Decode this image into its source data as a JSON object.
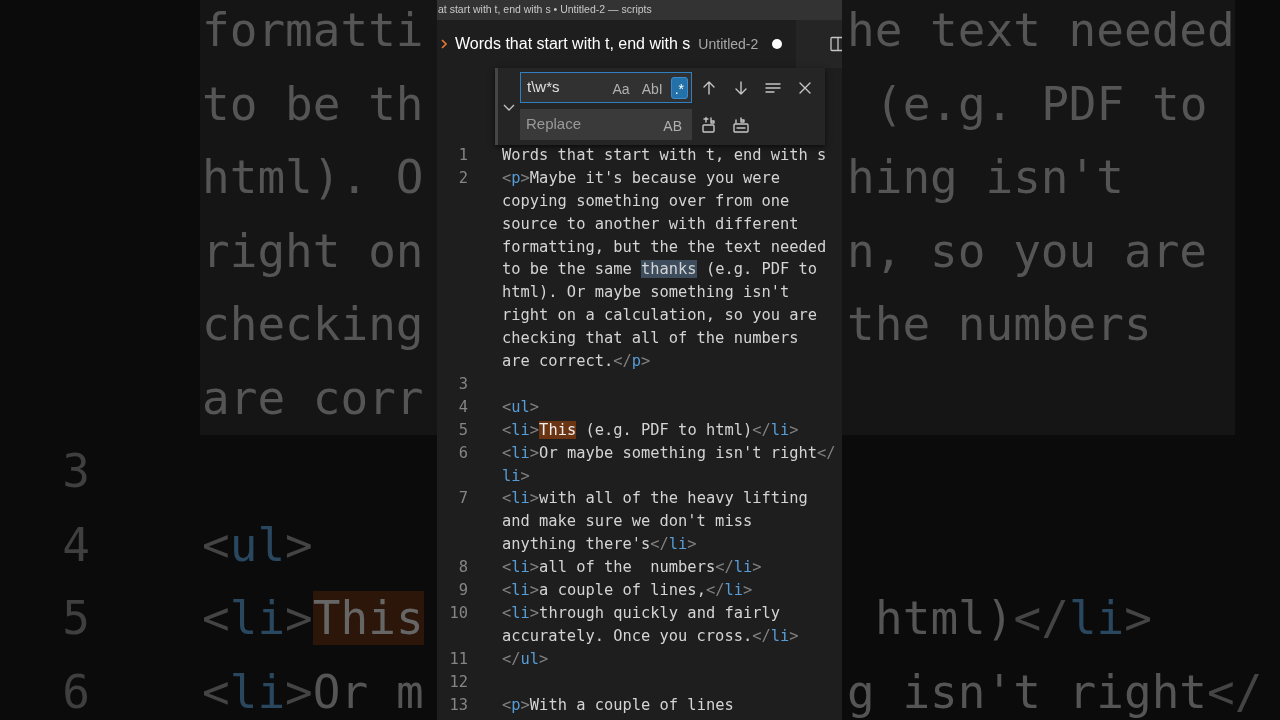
{
  "window": {
    "title": "at start with t, end with s • Untitled-2 — scripts"
  },
  "tab": {
    "title": "Words that start with t, end with s",
    "description": "Untitled-2",
    "dirty": true
  },
  "find": {
    "expanded": true,
    "query": "t\\w*s",
    "toggles": [
      {
        "label": "Aa",
        "on": false
      },
      {
        "label": "AbI",
        "on": false
      },
      {
        "label": ".*",
        "on": true
      }
    ],
    "replace": {
      "placeholder": "Replace",
      "toggles": [
        {
          "label": "AB",
          "on": false
        }
      ]
    }
  },
  "editor": {
    "lines": [
      {
        "number": "1",
        "rows": [
          {
            "tokens": [
              {
                "kind": "text",
                "text": "Words that start with t, end with s"
              }
            ]
          }
        ]
      },
      {
        "number": "2",
        "rows": [
          {
            "tokens": [
              {
                "kind": "punct",
                "text": "<"
              },
              {
                "kind": "tag",
                "text": "p"
              },
              {
                "kind": "punct",
                "text": ">"
              },
              {
                "kind": "text",
                "text": "Maybe it's because you were"
              }
            ]
          },
          {
            "tokens": [
              {
                "kind": "text",
                "text": "copying something over from one"
              }
            ]
          },
          {
            "tokens": [
              {
                "kind": "text",
                "text": "source to another with different"
              }
            ]
          },
          {
            "tokens": [
              {
                "kind": "text",
                "text": "formatting, but the the text needed"
              }
            ]
          },
          {
            "tokens": [
              {
                "kind": "text",
                "text": "to be the same "
              },
              {
                "kind": "match",
                "text": "thanks"
              },
              {
                "kind": "text",
                "text": " (e.g. PDF to"
              }
            ]
          },
          {
            "tokens": [
              {
                "kind": "text",
                "text": "html). Or maybe something isn't"
              }
            ]
          },
          {
            "tokens": [
              {
                "kind": "text",
                "text": "right on a calculation, so you are"
              }
            ]
          },
          {
            "tokens": [
              {
                "kind": "text",
                "text": "checking that all of the numbers"
              }
            ]
          },
          {
            "tokens": [
              {
                "kind": "text",
                "text": "are correct."
              },
              {
                "kind": "punct",
                "text": "</"
              },
              {
                "kind": "tag",
                "text": "p"
              },
              {
                "kind": "punct",
                "text": ">"
              }
            ]
          }
        ]
      },
      {
        "number": "3"
      },
      {
        "number": "4",
        "rows": [
          {
            "tokens": [
              {
                "kind": "punct",
                "text": "<"
              },
              {
                "kind": "tag",
                "text": "ul"
              },
              {
                "kind": "punct",
                "text": ">"
              }
            ]
          }
        ]
      },
      {
        "number": "5",
        "rows": [
          {
            "tokens": [
              {
                "kind": "punct",
                "text": "<"
              },
              {
                "kind": "tag",
                "text": "li"
              },
              {
                "kind": "punct",
                "text": ">"
              },
              {
                "kind": "current-match",
                "text": "This"
              },
              {
                "kind": "text",
                "text": " (e.g. PDF to html)"
              },
              {
                "kind": "punct",
                "text": "</"
              },
              {
                "kind": "tag",
                "text": "li"
              },
              {
                "kind": "punct",
                "text": ">"
              }
            ]
          }
        ]
      },
      {
        "number": "6",
        "rows": [
          {
            "tokens": [
              {
                "kind": "punct",
                "text": "<"
              },
              {
                "kind": "tag",
                "text": "li"
              },
              {
                "kind": "punct",
                "text": ">"
              },
              {
                "kind": "text",
                "text": "Or maybe something isn't right"
              },
              {
                "kind": "punct",
                "text": "</"
              }
            ]
          },
          {
            "tokens": [
              {
                "kind": "tag",
                "text": "li"
              },
              {
                "kind": "punct",
                "text": ">"
              }
            ]
          }
        ]
      },
      {
        "number": "7",
        "rows": [
          {
            "tokens": [
              {
                "kind": "punct",
                "text": "<"
              },
              {
                "kind": "tag",
                "text": "li"
              },
              {
                "kind": "punct",
                "text": ">"
              },
              {
                "kind": "text",
                "text": "with all of the heavy lifting"
              }
            ]
          },
          {
            "tokens": [
              {
                "kind": "text",
                "text": "and make sure we don't miss"
              }
            ]
          },
          {
            "tokens": [
              {
                "kind": "text",
                "text": "anything there's"
              },
              {
                "kind": "punct",
                "text": "</"
              },
              {
                "kind": "tag",
                "text": "li"
              },
              {
                "kind": "punct",
                "text": ">"
              }
            ]
          }
        ]
      },
      {
        "number": "8",
        "rows": [
          {
            "tokens": [
              {
                "kind": "punct",
                "text": "<"
              },
              {
                "kind": "tag",
                "text": "li"
              },
              {
                "kind": "punct",
                "text": ">"
              },
              {
                "kind": "text",
                "text": "all of the  numbers"
              },
              {
                "kind": "punct",
                "text": "</"
              },
              {
                "kind": "tag",
                "text": "li"
              },
              {
                "kind": "punct",
                "text": ">"
              }
            ]
          }
        ]
      },
      {
        "number": "9",
        "rows": [
          {
            "tokens": [
              {
                "kind": "punct",
                "text": "<"
              },
              {
                "kind": "tag",
                "text": "li"
              },
              {
                "kind": "punct",
                "text": ">"
              },
              {
                "kind": "text",
                "text": "a couple of lines,"
              },
              {
                "kind": "punct",
                "text": "</"
              },
              {
                "kind": "tag",
                "text": "li"
              },
              {
                "kind": "punct",
                "text": ">"
              }
            ]
          }
        ]
      },
      {
        "number": "10",
        "rows": [
          {
            "tokens": [
              {
                "kind": "punct",
                "text": "<"
              },
              {
                "kind": "tag",
                "text": "li"
              },
              {
                "kind": "punct",
                "text": ">"
              },
              {
                "kind": "text",
                "text": "through quickly and fairly"
              }
            ]
          },
          {
            "tokens": [
              {
                "kind": "text",
                "text": "accurately. Once you cross."
              },
              {
                "kind": "punct",
                "text": "</"
              },
              {
                "kind": "tag",
                "text": "li"
              },
              {
                "kind": "punct",
                "text": ">"
              }
            ]
          }
        ]
      },
      {
        "number": "11",
        "rows": [
          {
            "tokens": [
              {
                "kind": "punct",
                "text": "</"
              },
              {
                "kind": "tag",
                "text": "ul"
              },
              {
                "kind": "punct",
                "text": ">"
              }
            ]
          }
        ]
      },
      {
        "number": "12"
      },
      {
        "number": "13",
        "rows": [
          {
            "tokens": [
              {
                "kind": "punct",
                "text": "<"
              },
              {
                "kind": "tag",
                "text": "p"
              },
              {
                "kind": "punct",
                "text": ">"
              },
              {
                "kind": "text",
                "text": "With a couple of lines"
              }
            ]
          }
        ]
      }
    ]
  },
  "backdrop": {
    "left": [
      {
        "tokens": [
          {
            "kind": "text",
            "text": "formatti"
          }
        ]
      },
      {
        "tokens": [
          {
            "kind": "text",
            "text": "to be th"
          }
        ]
      },
      {
        "tokens": [
          {
            "kind": "text",
            "text": "html). O"
          }
        ]
      },
      {
        "tokens": [
          {
            "kind": "text",
            "text": "right on"
          }
        ]
      },
      {
        "tokens": [
          {
            "kind": "text",
            "text": "checking"
          }
        ]
      },
      {
        "tokens": [
          {
            "kind": "text",
            "text": "are corr"
          }
        ]
      },
      {
        "number": "3"
      },
      {
        "number": "4",
        "tokens": [
          {
            "kind": "punct",
            "text": "<"
          },
          {
            "kind": "tag",
            "text": "ul"
          },
          {
            "kind": "punct",
            "text": ">"
          }
        ]
      },
      {
        "number": "5",
        "tokens": [
          {
            "kind": "punct",
            "text": "<"
          },
          {
            "kind": "tag",
            "text": "li"
          },
          {
            "kind": "punct",
            "text": ">"
          },
          {
            "kind": "current-match",
            "text": "This"
          }
        ]
      },
      {
        "number": "6",
        "tokens": [
          {
            "kind": "punct",
            "text": "<"
          },
          {
            "kind": "tag",
            "text": "li"
          },
          {
            "kind": "punct",
            "text": ">"
          },
          {
            "kind": "text",
            "text": "Or m"
          }
        ]
      }
    ],
    "right": [
      {
        "tokens": [
          {
            "kind": "text",
            "text": "he text needed"
          }
        ]
      },
      {
        "tokens": [
          {
            "kind": "text",
            "text": "(e.g. PDF to"
          }
        ]
      },
      {
        "tokens": [
          {
            "kind": "text",
            "text": "hing isn't"
          }
        ]
      },
      {
        "tokens": [
          {
            "kind": "text",
            "text": "n, so you are"
          }
        ]
      },
      {
        "tokens": [
          {
            "kind": "text",
            "text": "the numbers"
          }
        ]
      },
      {
        "tokens": [
          {
            "kind": "text",
            "text": "html)"
          },
          {
            "kind": "punct",
            "text": "</"
          },
          {
            "kind": "tag",
            "text": "li"
          },
          {
            "kind": "punct",
            "text": ">"
          }
        ]
      },
      {
        "tokens": [
          {
            "kind": "text",
            "text": "g isn't right"
          },
          {
            "kind": "punct",
            "text": "</"
          }
        ]
      }
    ]
  }
}
